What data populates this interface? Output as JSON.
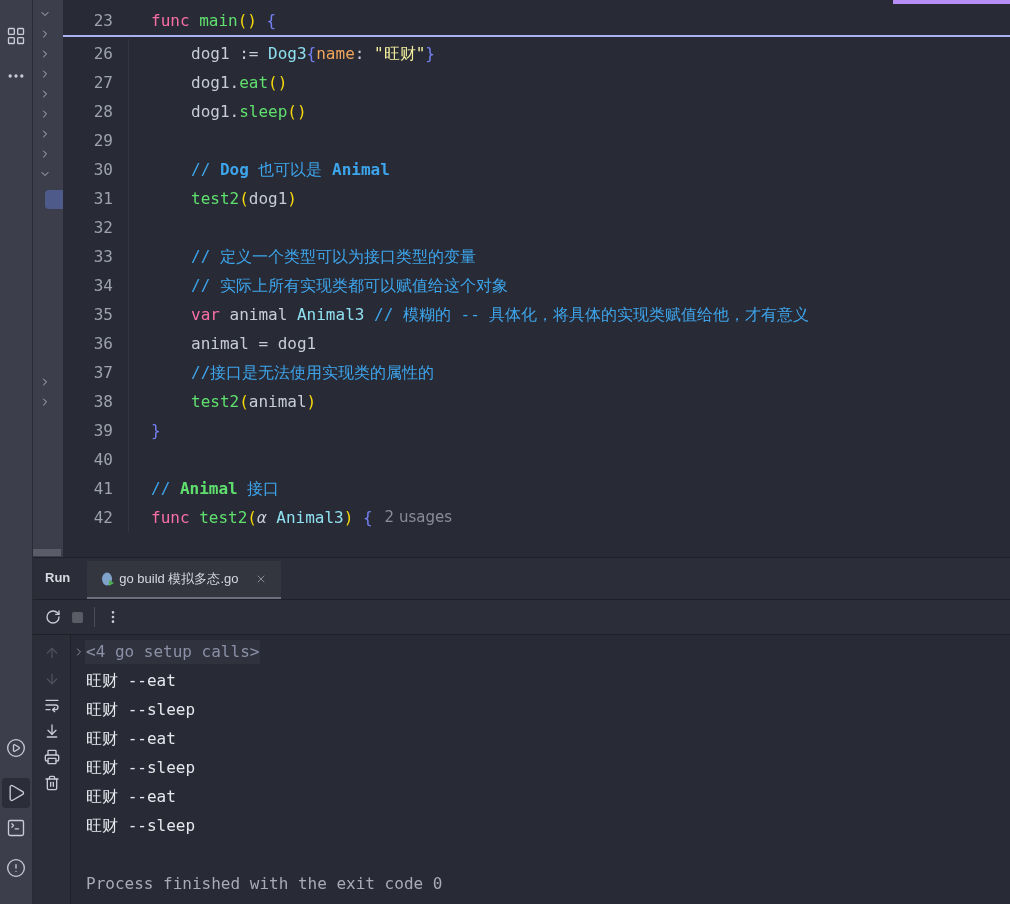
{
  "editor": {
    "lines": [
      {
        "number": "23",
        "sticky": true,
        "indented": false,
        "tokens": [
          {
            "kind": "keyword",
            "text": "func "
          },
          {
            "kind": "function",
            "text": "main"
          },
          {
            "kind": "paren",
            "text": "()"
          },
          {
            "kind": "brace",
            "text": " {"
          }
        ]
      },
      {
        "number": "26",
        "sticky": false,
        "indented": true,
        "tokens": [
          {
            "kind": "plain",
            "text": "dog1 := "
          },
          {
            "kind": "type",
            "text": "Dog3"
          },
          {
            "kind": "brace",
            "text": "{"
          },
          {
            "kind": "field",
            "text": "name"
          },
          {
            "kind": "plain",
            "text": ": "
          },
          {
            "kind": "string",
            "text": "\"旺财\""
          },
          {
            "kind": "brace",
            "text": "}"
          }
        ]
      },
      {
        "number": "27",
        "sticky": false,
        "indented": true,
        "tokens": [
          {
            "kind": "plain",
            "text": "dog1."
          },
          {
            "kind": "function",
            "text": "eat"
          },
          {
            "kind": "paren",
            "text": "()"
          }
        ]
      },
      {
        "number": "28",
        "sticky": false,
        "indented": true,
        "tokens": [
          {
            "kind": "plain",
            "text": "dog1."
          },
          {
            "kind": "function",
            "text": "sleep"
          },
          {
            "kind": "paren",
            "text": "()"
          }
        ]
      },
      {
        "number": "29",
        "sticky": false
      },
      {
        "number": "30",
        "sticky": false,
        "indented": true,
        "tokens": [
          {
            "kind": "comment",
            "text": "// "
          },
          {
            "kind": "comment_ref",
            "text": "Dog"
          },
          {
            "kind": "comment",
            "text": " 也可以是 "
          },
          {
            "kind": "comment_ref",
            "text": "Animal"
          }
        ]
      },
      {
        "number": "31",
        "sticky": false,
        "indented": true,
        "tokens": [
          {
            "kind": "function",
            "text": "test2"
          },
          {
            "kind": "paren",
            "text": "("
          },
          {
            "kind": "plain",
            "text": "dog1"
          },
          {
            "kind": "paren",
            "text": ")"
          }
        ]
      },
      {
        "number": "32",
        "sticky": false
      },
      {
        "number": "33",
        "sticky": false,
        "indented": true,
        "tokens": [
          {
            "kind": "comment",
            "text": "// 定义一个类型可以为接口类型的变量"
          }
        ]
      },
      {
        "number": "34",
        "sticky": false,
        "indented": true,
        "tokens": [
          {
            "kind": "comment",
            "text": "// 实际上所有实现类都可以赋值给这个对象"
          }
        ]
      },
      {
        "number": "35",
        "sticky": false,
        "indented": true,
        "tokens": [
          {
            "kind": "keyword",
            "text": "var "
          },
          {
            "kind": "plain",
            "text": "animal "
          },
          {
            "kind": "type",
            "text": "Animal3"
          },
          {
            "kind": "comment",
            "text": " // 模糊的 -- 具体化，将具体的实现类赋值给他，才有意义"
          }
        ]
      },
      {
        "number": "36",
        "sticky": false,
        "indented": true,
        "tokens": [
          {
            "kind": "plain",
            "text": "animal = dog1"
          }
        ]
      },
      {
        "number": "37",
        "sticky": false,
        "indented": true,
        "tokens": [
          {
            "kind": "comment",
            "text": "//接口是无法使用实现类的属性的"
          }
        ]
      },
      {
        "number": "38",
        "sticky": false,
        "indented": true,
        "tokens": [
          {
            "kind": "function",
            "text": "test2"
          },
          {
            "kind": "paren",
            "text": "("
          },
          {
            "kind": "plain",
            "text": "animal"
          },
          {
            "kind": "paren",
            "text": ")"
          }
        ]
      },
      {
        "number": "39",
        "sticky": false,
        "indented": false,
        "tokens": [
          {
            "kind": "brace",
            "text": "}"
          }
        ]
      },
      {
        "number": "40",
        "sticky": false
      },
      {
        "number": "41",
        "sticky": false,
        "indented": false,
        "tokens": [
          {
            "kind": "comment",
            "text": "// "
          },
          {
            "kind": "comment_type",
            "text": "Animal"
          },
          {
            "kind": "comment",
            "text": " 接口"
          }
        ]
      },
      {
        "number": "42",
        "sticky": false,
        "indented": false,
        "tokens": [
          {
            "kind": "keyword",
            "text": "func "
          },
          {
            "kind": "function",
            "text": "test2"
          },
          {
            "kind": "paren",
            "text": "("
          },
          {
            "kind": "param",
            "text": "α"
          },
          {
            "kind": "type",
            "text": " Animal3"
          },
          {
            "kind": "paren",
            "text": ")"
          },
          {
            "kind": "brace",
            "text": " {"
          }
        ],
        "hint": "2 usages"
      }
    ]
  },
  "run_panel": {
    "title": "Run",
    "tabs": [
      {
        "label": "go build 模拟多态.go",
        "selected": true
      }
    ],
    "console": [
      {
        "kind": "folded",
        "text": "<4 go setup calls>"
      },
      {
        "kind": "output",
        "text": "旺财 --eat"
      },
      {
        "kind": "output",
        "text": "旺财 --sleep"
      },
      {
        "kind": "output",
        "text": "旺财 --eat"
      },
      {
        "kind": "output",
        "text": "旺财 --sleep"
      },
      {
        "kind": "output",
        "text": "旺财 --eat"
      },
      {
        "kind": "output",
        "text": "旺财 --sleep"
      },
      {
        "kind": "exit",
        "text": "Process finished with the exit code 0"
      }
    ]
  }
}
